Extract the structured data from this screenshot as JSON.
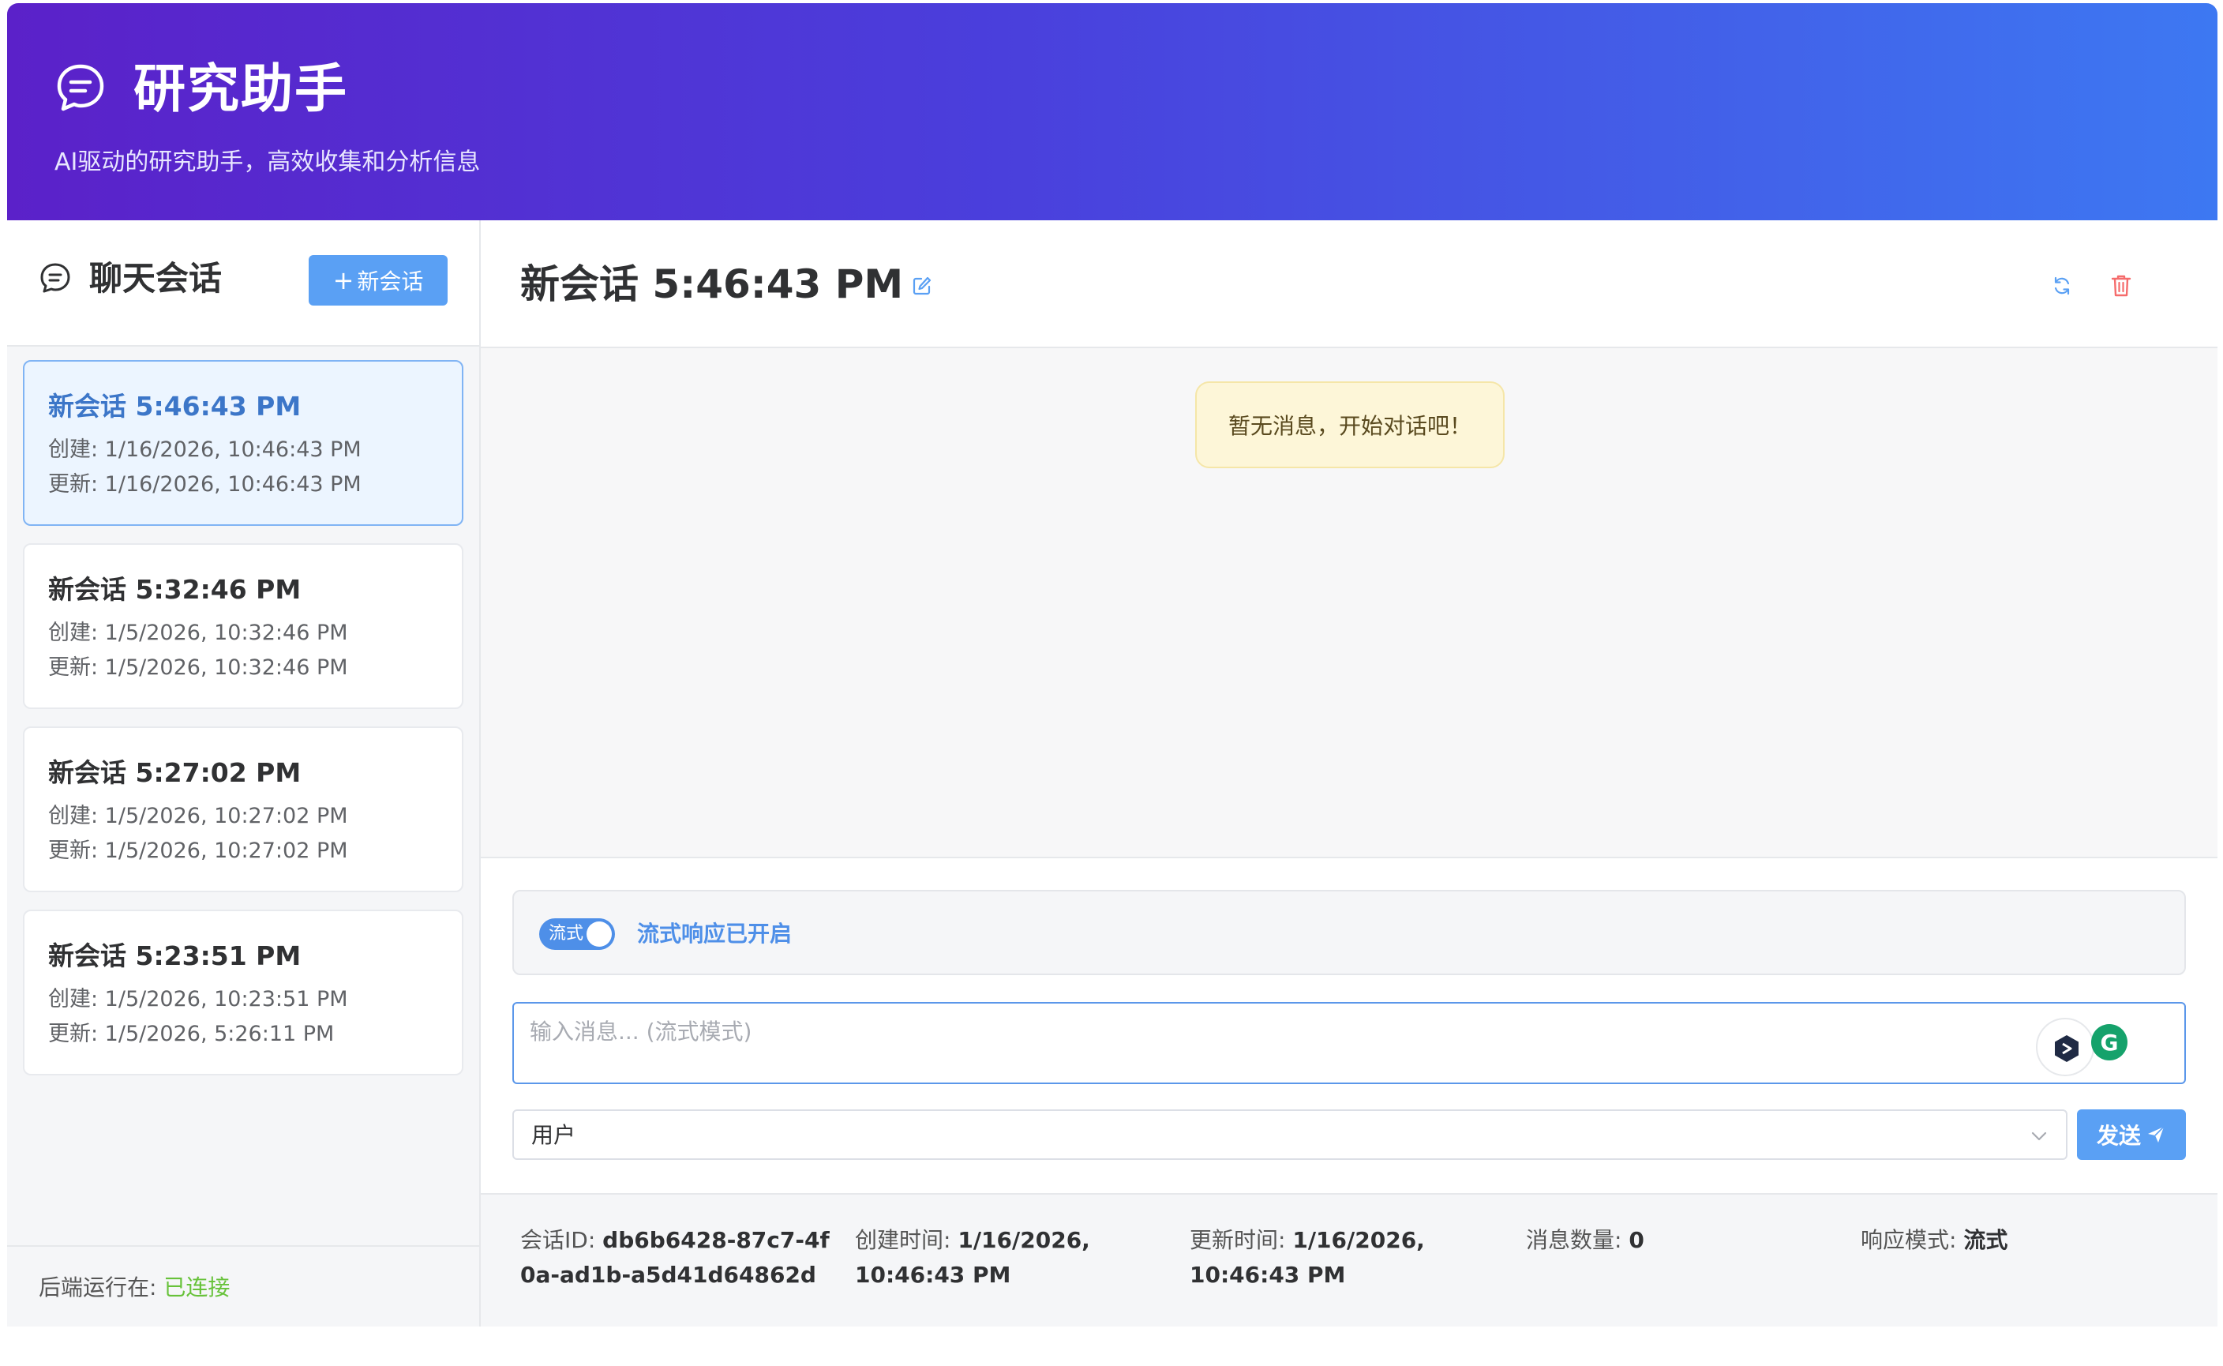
{
  "header": {
    "title": "研究助手",
    "subtitle": "AI驱动的研究助手，高效收集和分析信息",
    "logo_icon": "chat-bubble-icon"
  },
  "sidebar": {
    "title": "聊天会话",
    "new_button_plus": "+",
    "new_button_label": "新会话",
    "sessions": [
      {
        "title": "新会话 5:46:43 PM",
        "created": "创建: 1/16/2026, 10:46:43 PM",
        "updated": "更新: 1/16/2026, 10:46:43 PM"
      },
      {
        "title": "新会话 5:32:46 PM",
        "created": "创建: 1/5/2026, 10:32:46 PM",
        "updated": "更新: 1/5/2026, 10:32:46 PM"
      },
      {
        "title": "新会话 5:27:02 PM",
        "created": "创建: 1/5/2026, 10:27:02 PM",
        "updated": "更新: 1/5/2026, 10:27:02 PM"
      },
      {
        "title": "新会话 5:23:51 PM",
        "created": "创建: 1/5/2026, 10:23:51 PM",
        "updated": "更新: 1/5/2026, 5:26:11 PM"
      }
    ],
    "footer_label": "后端运行在: ",
    "footer_status": "已连接"
  },
  "main": {
    "conversation_title": "新会话 5:46:43 PM",
    "empty_message": "暂无消息，开始对话吧！",
    "stream_toggle_label": "流式",
    "stream_status": "流式响应已开启",
    "input_placeholder": "输入消息... (流式模式)",
    "role_value": "用户",
    "send_label": "发送",
    "ext_badge_letter": "G"
  },
  "info": {
    "session_id_label": "会话ID: ",
    "session_id": "db6b6428-87c7-4f0a-ad1b-a5d41d64862d",
    "created_label": "创建时间: ",
    "created": "1/16/2026, 10:46:43 PM",
    "updated_label": "更新时间: ",
    "updated": "1/16/2026, 10:46:43 PM",
    "count_label": "消息数量: ",
    "count": "0",
    "mode_label": "响应模式: ",
    "mode": "流式"
  },
  "colors": {
    "header_gradient_start": "#5b21c9",
    "header_gradient_end": "#3d78f2",
    "primary": "#5aa0f4",
    "active_title": "#3c76c8",
    "connected": "#67c23a",
    "danger": "#f56c6c"
  }
}
